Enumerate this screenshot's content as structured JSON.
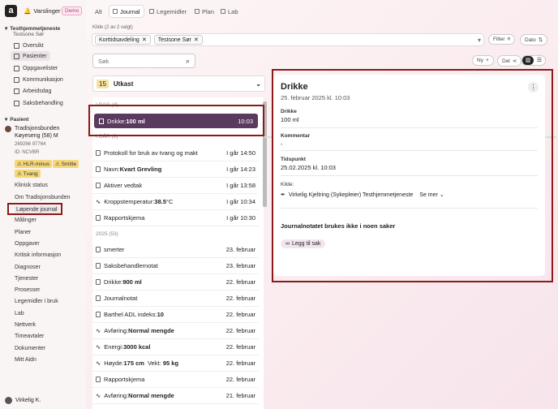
{
  "header": {
    "logo": "a",
    "notifications": "Varslinger",
    "demo": "Demo"
  },
  "sidebar": {
    "org": "Testhjemmetjeneste",
    "org_sub": "Testsone Sør",
    "items": [
      {
        "label": "Oversikt"
      },
      {
        "label": "Pasienter"
      },
      {
        "label": "Oppgavelister"
      },
      {
        "label": "Kommunikasjon"
      },
      {
        "label": "Arbeidsdag"
      },
      {
        "label": "Saksbehandling"
      }
    ],
    "patient_heading": "Pasient",
    "patient_name": "Tradisjonsbunden",
    "patient_name2": "Køyeseng (58) M",
    "patient_id": "269266 97764",
    "patient_ident": "ID: NCVBR",
    "badges": [
      "HLR-minus",
      "Smitte",
      "Tvang"
    ],
    "links": [
      "Klinisk status",
      "Om Tradisjonsbunden",
      "Løpende journal",
      "Målinger",
      "Planer",
      "Oppgaver",
      "Kritisk informasjon",
      "Diagnoser",
      "Tjenester",
      "Prosesser",
      "Legemidler i bruk",
      "Lab",
      "Nettverk",
      "Timeavtaler",
      "Dokumenter",
      "Mitt Aidn"
    ],
    "user": "Virkelig K."
  },
  "tabs": [
    {
      "label": "Alt"
    },
    {
      "label": "Journal"
    },
    {
      "label": "Legemidler"
    },
    {
      "label": "Plan"
    },
    {
      "label": "Lab"
    }
  ],
  "filter": {
    "label": "Kilde (2 av 2 valgt)",
    "chips": [
      "Korttidsavdeling",
      "Testsone Sør"
    ],
    "filter_btn": "Filter",
    "date_btn": "Dato"
  },
  "search": {
    "placeholder": "Søk"
  },
  "toolbar": {
    "new": "Ny",
    "share": "Del"
  },
  "draft": {
    "count": "15",
    "label": "Utkast"
  },
  "list": {
    "section_today": "I DAG (4)",
    "selected": {
      "label": "Drikke: ",
      "bold": "100 ml",
      "time": "10:03"
    },
    "section_yesterday": "I GÅR (6)",
    "items": [
      {
        "label": "Protokoll for bruk av tvang og makt",
        "bold": "",
        "time": "I går 14:50"
      },
      {
        "label": "Navn: ",
        "bold": "Kvart Grevling",
        "time": "I går 14:23"
      },
      {
        "label": "Aktiver vedtak",
        "bold": "",
        "time": "I går 13:58"
      },
      {
        "label": "Kroppstemperatur: ",
        "bold": "38.5",
        "suffix": " °C",
        "time": "I går 10:34"
      },
      {
        "label": "Rapportskjema",
        "bold": "",
        "time": "I går 10:30"
      }
    ],
    "year": "2025 (53)",
    "items2": [
      {
        "label": "smerter",
        "bold": "",
        "time": "23. februar"
      },
      {
        "label": "Saksbehandlernotat",
        "bold": "",
        "time": "23. februar"
      },
      {
        "label": "Drikke: ",
        "bold": "900 ml",
        "time": "22. februar"
      },
      {
        "label": "Journalnotat",
        "bold": "",
        "time": "22. februar"
      },
      {
        "label": "Barthel ADL indeks: ",
        "bold": "10",
        "time": "22. februar"
      },
      {
        "label": "Avføring: ",
        "bold": "Normal mengde",
        "time": "22. februar"
      },
      {
        "label": "Energi: ",
        "bold": "3000 kcal",
        "time": "22. februar"
      },
      {
        "label": "Høyde: ",
        "bold": "175 cm",
        "extra": "  Vekt: ",
        "bold2": "95 kg",
        "time": "22. februar"
      },
      {
        "label": "Rapportskjema",
        "bold": "",
        "time": "22. februar"
      },
      {
        "label": "Avføring: ",
        "bold": "Normal mengde",
        "time": "21. februar"
      }
    ]
  },
  "detail": {
    "title": "Drikke",
    "subtitle": "25. februar 2025 kl. 10:03",
    "f1_label": "Drikke",
    "f1_value": "100 ml",
    "f2_label": "Kommentar",
    "f2_value": "-",
    "f3_label": "Tidspunkt",
    "f3_value": "25.02.2025 kl. 10:03",
    "f4_label": "Kilde:",
    "f4_value": "Virkelig Kjeltring (Sykepleier) Testhjemmetjeneste",
    "see_more": "Se mer",
    "cases_title": "Journalnotatet brukes ikke i noen saker",
    "add_case": "Legg til sak"
  },
  "colors": {
    "selected_bg": "#5a3a5e",
    "highlight": "#8b1a1a",
    "accent": "#c23b7e"
  }
}
